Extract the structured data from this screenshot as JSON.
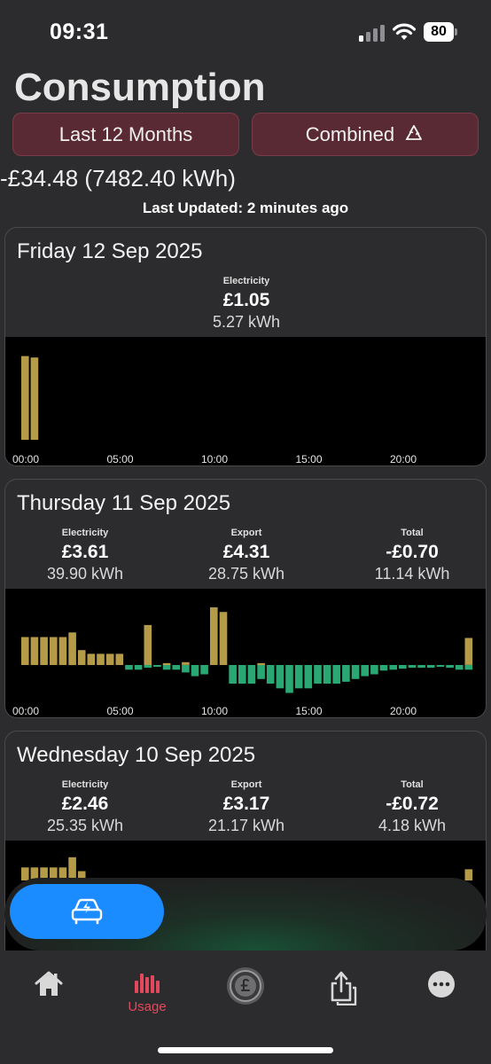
{
  "status": {
    "time": "09:31",
    "battery": "80"
  },
  "header": {
    "title": "Consumption",
    "period_label": "Last 12 Months",
    "mode_label": "Combined",
    "summary": "-£34.48 (7482.40 kWh)",
    "updated": "Last Updated: 2 minutes ago"
  },
  "days": [
    {
      "date": "Friday 12 Sep 2025",
      "electricity": {
        "label": "Electricity",
        "cost": "£1.05",
        "kwh": "5.27 kWh"
      },
      "chart_ticks": [
        "00:00",
        "05:00",
        "10:00",
        "15:00",
        "20:00"
      ]
    },
    {
      "date": "Thursday 11 Sep 2025",
      "electricity": {
        "label": "Electricity",
        "cost": "£3.61",
        "kwh": "39.90 kWh"
      },
      "export": {
        "label": "Export",
        "cost": "£4.31",
        "kwh": "28.75 kWh"
      },
      "total": {
        "label": "Total",
        "cost": "-£0.70",
        "kwh": "11.14 kWh"
      },
      "chart_ticks": [
        "00:00",
        "05:00",
        "10:00",
        "15:00",
        "20:00"
      ]
    },
    {
      "date": "Wednesday 10 Sep 2025",
      "electricity": {
        "label": "Electricity",
        "cost": "£2.46",
        "kwh": "25.35 kWh"
      },
      "export": {
        "label": "Export",
        "cost": "£3.17",
        "kwh": "21.17 kWh"
      },
      "total": {
        "label": "Total",
        "cost": "-£0.72",
        "kwh": "4.18 kWh"
      }
    }
  ],
  "chart_data": [
    {
      "type": "bar",
      "x_unit": "half-hour slot",
      "series": [
        {
          "name": "Electricity",
          "color": "#b59a48",
          "values": [
            1.18,
            1.16,
            0,
            0,
            0,
            0,
            0,
            0,
            0,
            0,
            0,
            0,
            0,
            0,
            0,
            0,
            0,
            0,
            0,
            0,
            0,
            0,
            0,
            0,
            0,
            0,
            0,
            0,
            0,
            0,
            0,
            0,
            0,
            0,
            0,
            0,
            0,
            0,
            0,
            0,
            0,
            0,
            0,
            0,
            0,
            0,
            0,
            0
          ]
        }
      ]
    },
    {
      "type": "bar",
      "x_unit": "half-hour slot",
      "series": [
        {
          "name": "Electricity",
          "color": "#b59a48",
          "values": [
            0.3,
            0.3,
            0.3,
            0.3,
            0.3,
            0.35,
            0.16,
            0.12,
            0.12,
            0.12,
            0.12,
            0,
            0,
            0.43,
            0,
            0.02,
            0,
            0.03,
            0,
            0,
            0.62,
            0.57,
            0,
            0,
            0,
            0.02,
            0,
            0,
            0,
            0,
            0,
            0,
            0,
            0,
            0,
            0,
            0,
            0,
            0,
            0,
            0,
            0,
            0,
            0,
            0,
            0,
            0,
            0.29
          ]
        },
        {
          "name": "Export",
          "color": "#2aa874",
          "values": [
            0,
            0,
            0,
            0,
            0,
            0,
            0,
            0,
            0,
            0,
            0,
            0.05,
            0.05,
            0.03,
            0.02,
            0.05,
            0.05,
            0.08,
            0.12,
            0.1,
            0,
            0,
            0.2,
            0.2,
            0.2,
            0.15,
            0.2,
            0.25,
            0.3,
            0.25,
            0.25,
            0.2,
            0.2,
            0.2,
            0.18,
            0.15,
            0.12,
            0.1,
            0.06,
            0.05,
            0.04,
            0.03,
            0.03,
            0.03,
            0.02,
            0.03,
            0.05,
            0.05
          ]
        }
      ]
    },
    {
      "type": "bar",
      "x_unit": "half-hour slot",
      "series": [
        {
          "name": "Electricity",
          "color": "#b59a48",
          "values": [
            0.14,
            0.14,
            0.14,
            0.14,
            0.14,
            0.25,
            0.1,
            0,
            0,
            0,
            0,
            0,
            0,
            0,
            0,
            0,
            0,
            0,
            0,
            0,
            0,
            0,
            0,
            0,
            0,
            0,
            0,
            0,
            0,
            0,
            0,
            0,
            0,
            0,
            0,
            0,
            0,
            0,
            0,
            0,
            0,
            0,
            0,
            0,
            0,
            0,
            0,
            0.12
          ]
        }
      ]
    }
  ],
  "tabs": [
    {
      "id": "home",
      "label": ""
    },
    {
      "id": "usage",
      "label": "Usage"
    },
    {
      "id": "tariff",
      "label": ""
    },
    {
      "id": "share",
      "label": ""
    },
    {
      "id": "more",
      "label": ""
    }
  ],
  "colors": {
    "import": "#b59a48",
    "export": "#2aa874",
    "accent": "#e5475c",
    "button": "#5a2a34",
    "charge": "#1a8cff"
  }
}
